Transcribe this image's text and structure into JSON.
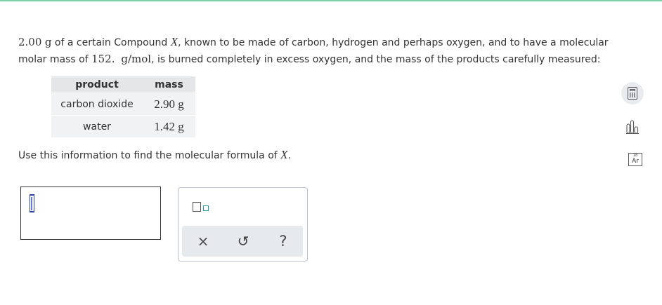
{
  "question": {
    "mass_value": "2.00",
    "mass_unit": "g",
    "text_1": " of a certain Compound ",
    "compound_symbol": "X",
    "text_2": ", known to be made of carbon, hydrogen and perhaps oxygen, and to have a molecular molar mass of ",
    "molar_mass_value": "152.",
    "molar_mass_unit": "g/mol",
    "text_3": ", is burned completely in excess oxygen, and the mass of the products carefully measured:"
  },
  "table": {
    "headers": [
      "product",
      "mass"
    ],
    "rows": [
      {
        "product": "carbon dioxide",
        "mass": "2.90 g"
      },
      {
        "product": "water",
        "mass": "1.42 g"
      }
    ]
  },
  "prompt": {
    "text": "Use this information to find the molecular formula of ",
    "symbol": "X",
    "end": "."
  },
  "answer": {
    "value": ""
  },
  "palette": {
    "tools": [
      "superscript-subscript"
    ],
    "actions": {
      "clear": "×",
      "undo": "↺",
      "help": "?"
    }
  },
  "side_tools": {
    "calculator": "calculator-icon",
    "data": "bar-chart-icon",
    "periodic_table": {
      "number": "18",
      "symbol": "Ar"
    }
  },
  "colors": {
    "accent_bar": "#7fd1a8",
    "cursor": "#2b3fa5",
    "superscript_box": "#1b9fb0"
  }
}
